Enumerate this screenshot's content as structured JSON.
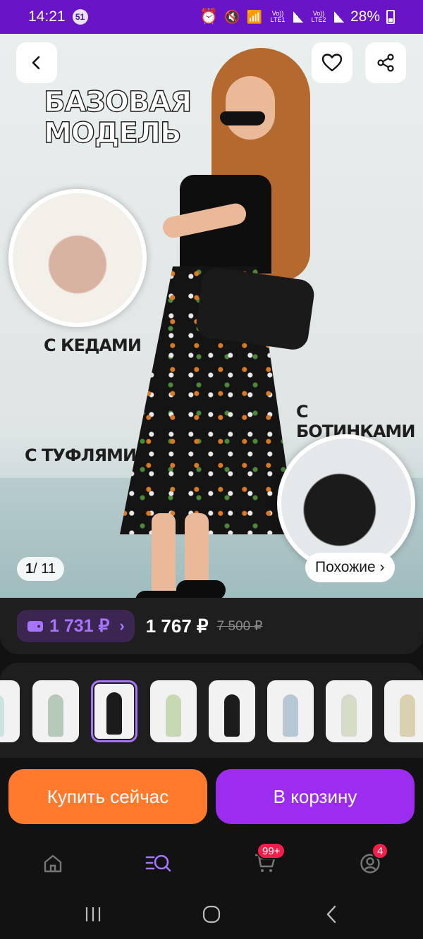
{
  "status_bar": {
    "time": "14:21",
    "notification_count": "51",
    "lte1": "Vo)) LTE1",
    "lte2": "Vo)) LTE2",
    "battery": "28%"
  },
  "hero": {
    "promo_title_line1": "БАЗОВАЯ",
    "promo_title_line2": "МОДЕЛЬ",
    "label_kedy": "С КЕДАМИ",
    "label_tufli": "С ТУФЛЯМИ",
    "label_botinki": "С БОТИНКАМИ",
    "pager_current": "1",
    "pager_total": "/ 11",
    "similar_label": "Похожие ›"
  },
  "price": {
    "wallet_price": "1 731 ₽",
    "wallet_chevron": "›",
    "price": "1 767 ₽",
    "old_price": "7 500 ₽"
  },
  "thumbnails": [
    {
      "color": "#cfe0e3"
    },
    {
      "color": "#b7c9b8"
    },
    {
      "color": "#1b1b1b"
    },
    {
      "color": "#c7d9b2"
    },
    {
      "color": "#1c1c1c"
    },
    {
      "color": "#b8c7d4"
    },
    {
      "color": "#d6dbc8"
    },
    {
      "color": "#d9d1b0"
    }
  ],
  "actions": {
    "buy_now": "Купить сейчас",
    "add_to_cart": "В корзину"
  },
  "bottom_nav": {
    "cart_badge": "99+",
    "profile_badge": "4"
  },
  "colors": {
    "accent_purple": "#9b2cf0",
    "accent_orange": "#ff7a2d",
    "status_bar": "#6a14c8"
  }
}
